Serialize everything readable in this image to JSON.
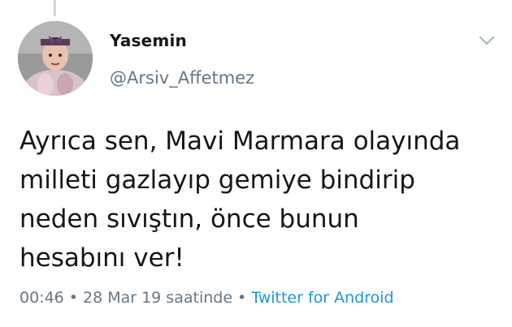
{
  "tweet": {
    "display_name": "Yasemin",
    "handle": "@Arsiv_Affetmez",
    "text": "Ayrıca sen, Mavi Marmara olayında\nmilleti gazlayıp gemiye bindirip\nneden sıvıştın, önce bunun\nhesabını ver!",
    "time": "00:46",
    "date": "28 Mar 19 saatinde",
    "separator": "•",
    "source": "Twitter for Android"
  },
  "icons": {
    "menu": "chevron-down-icon",
    "avatar": "profile-photo"
  },
  "colors": {
    "text": "#14171a",
    "secondary": "#657786",
    "link": "#1b95e0",
    "thread_line": "#ccd6dd"
  }
}
